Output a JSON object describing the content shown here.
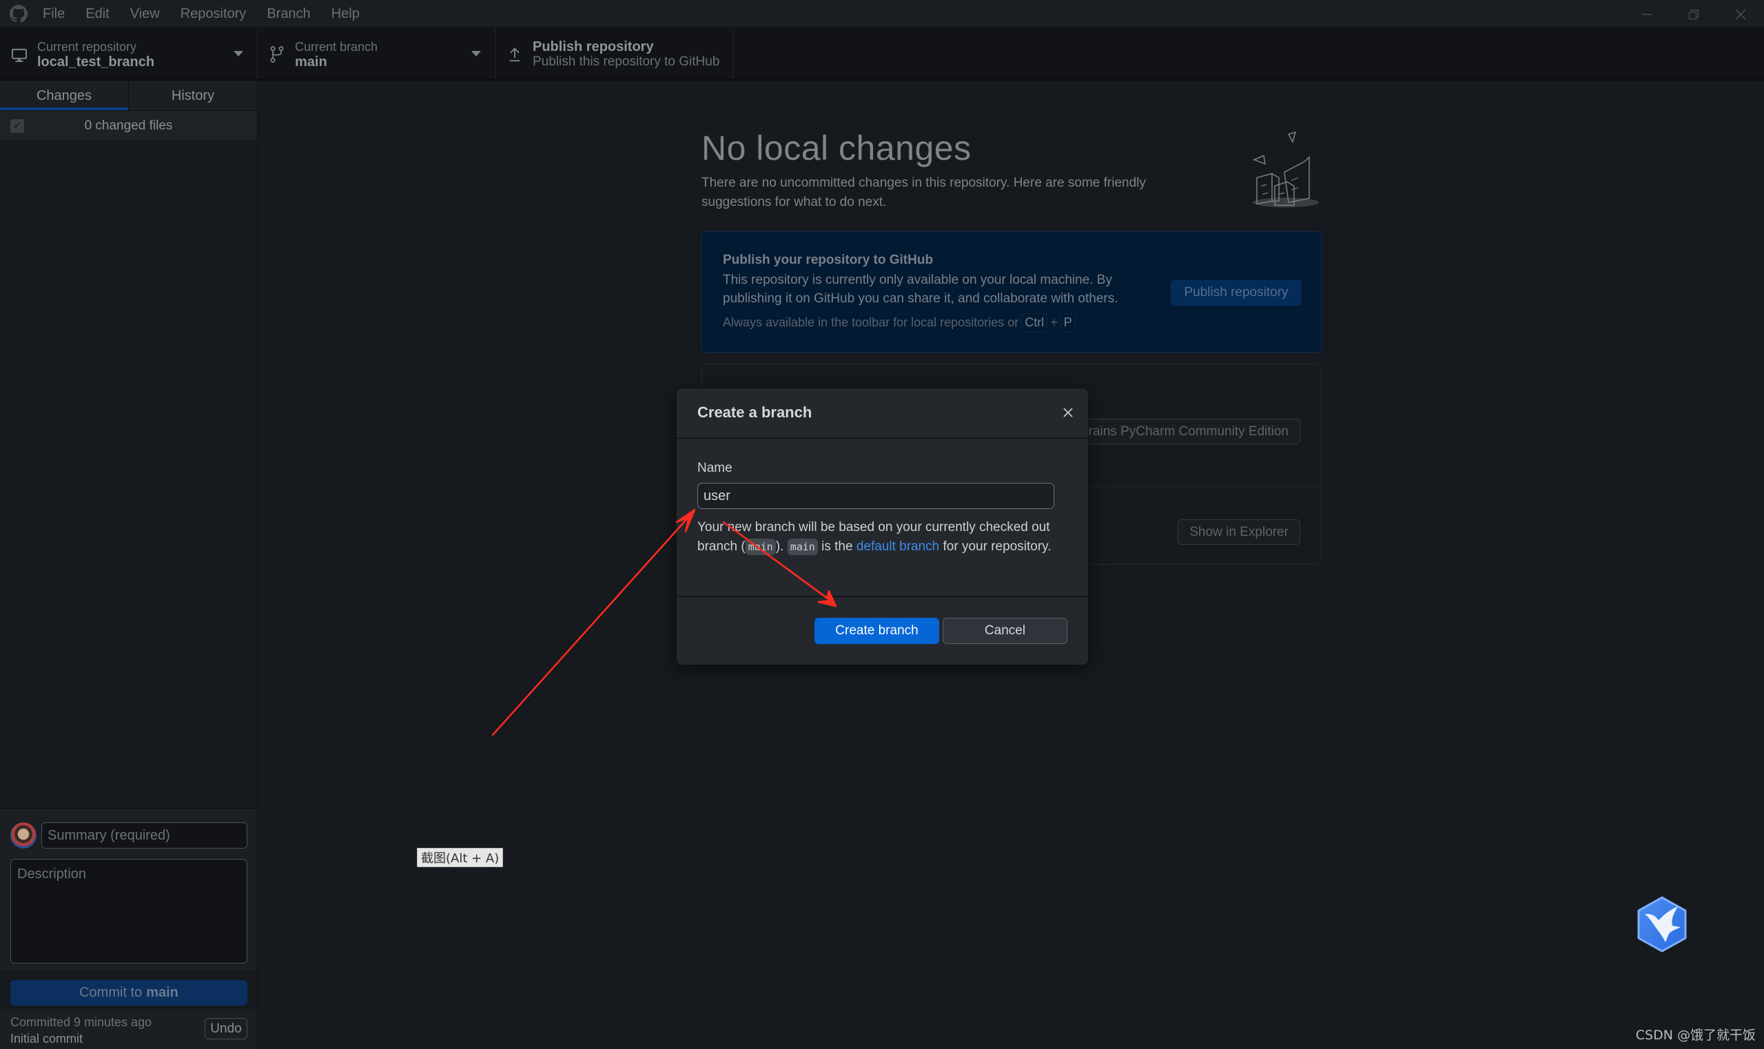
{
  "titlebar": {
    "logo_icon": "github-logo-icon",
    "menu": [
      "File",
      "Edit",
      "View",
      "Repository",
      "Branch",
      "Help"
    ],
    "window_controls": [
      "minimize-icon",
      "restore-icon",
      "close-icon"
    ]
  },
  "toolbar": {
    "repository": {
      "label": "Current repository",
      "value": "local_test_branch",
      "icon": "desktop-icon"
    },
    "branch": {
      "label": "Current branch",
      "value": "main",
      "icon": "git-branch-icon"
    },
    "publish": {
      "title": "Publish repository",
      "subtitle": "Publish this repository to GitHub",
      "icon": "upload-icon"
    }
  },
  "sidebar": {
    "tabs": [
      {
        "label": "Changes",
        "active": true
      },
      {
        "label": "History",
        "active": false
      }
    ],
    "changed_files": "0 changed files",
    "commit": {
      "summary_placeholder": "Summary (required)",
      "description_placeholder": "Description",
      "button_prefix": "Commit to",
      "button_branch": "main"
    },
    "last_commit": {
      "time": "Committed 9 minutes ago",
      "message": "Initial commit",
      "undo_label": "Undo"
    }
  },
  "main": {
    "title": "No local changes",
    "description": "There are no uncommitted changes in this repository. Here are some friendly suggestions for what to do next.",
    "publish_card": {
      "title": "Publish your repository to GitHub",
      "description": "This repository is currently only available on your local machine. By publishing it on GitHub you can share it, and collaborate with others.",
      "hint_prefix": "Always available in the toolbar for local repositories or",
      "shortcut_keys": [
        "Ctrl",
        "P"
      ],
      "shortcut_joiner": "+",
      "button": "Publish repository"
    },
    "actions": {
      "open_editor_button": "Open in JetBrains PyCharm Community Edition",
      "show_explorer_button": "Show in Explorer"
    }
  },
  "dialog": {
    "title": "Create a branch",
    "name_label": "Name",
    "name_value": "user",
    "desc_part1": "Your new branch will be based on your currently checked out branch (",
    "desc_code1": "main",
    "desc_part2": "). ",
    "desc_code2": "main",
    "desc_part3": " is the ",
    "desc_link": "default branch",
    "desc_part4": " for your repository.",
    "create_button": "Create branch",
    "cancel_button": "Cancel"
  },
  "overlays": {
    "screenshot_tooltip": "截图(Alt + A)",
    "watermark": "CSDN @饿了就干饭",
    "annotation_color": "#ff2a1f"
  },
  "colors": {
    "accent": "#0566d6",
    "link": "#3e8be8",
    "background": "#16191d"
  }
}
